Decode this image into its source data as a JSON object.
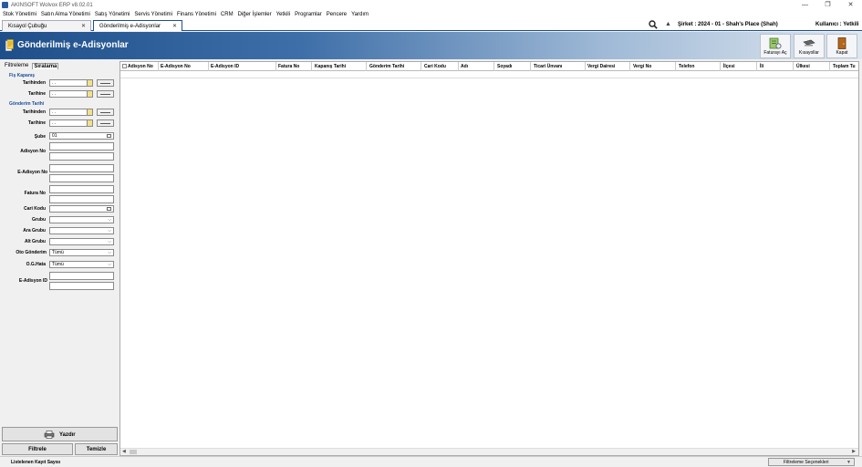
{
  "app": {
    "title": "AKINSOFT Wolvox ERP v8.02.01"
  },
  "window_controls": {
    "minimize": "—",
    "restore": "❐",
    "close": "✕"
  },
  "menu": [
    "Stok Yönetimi",
    "Satın Alma Yönetimi",
    "Satış Yönetimi",
    "Servis Yönetimi",
    "Finans Yönetimi",
    "CRM",
    "Diğer İşlemler",
    "Yetkili",
    "Programlar",
    "Pencere",
    "Yardım"
  ],
  "tabs": [
    {
      "label": "Kısayol Çubuğu",
      "close": "✕"
    },
    {
      "label": "Gönderilmiş e-Adisyonlar",
      "close": "✕"
    }
  ],
  "topbar": {
    "company": "Şirket : 2024 - 01 - Shah's Place (Shah)",
    "user": "Kullanıcı : Yetkili"
  },
  "header": {
    "title": "Gönderilmiş e-Adisyonlar",
    "buttons": [
      "Faturayı Aç",
      "Kısayollar",
      "Kapat"
    ]
  },
  "filter_tabs": [
    "Filtreleme",
    "Sıralama"
  ],
  "filters": {
    "fis_kapanis": "Fiş Kapanış",
    "gonderim_tarihi": "Gönderim Tarihi",
    "date_from": "Tarihinden",
    "date_to": "Tarihine",
    "date_placeholder": ". .",
    "sube_label": "Şube",
    "sube_value": "01",
    "adisyon_no": "Adisyon No",
    "e_adisyon_no": "E-Adisyon No",
    "fatura_no": "Fatura No",
    "cari_kodu": "Cari Kodu",
    "grubu": "Grubu",
    "ara_grubu": "Ara Grubu",
    "alt_grubu": "Alt Grubu",
    "oto_gonderim": "Oto Gönderim",
    "oto_gonderim_value": "Tümü",
    "og_hata": "O.G.Hata",
    "og_hata_value": "Tümü",
    "e_adisyon_id": "E-Adisyon ID"
  },
  "actions": {
    "print": "Yazdır",
    "filter": "Filtrele",
    "clear": "Temizle"
  },
  "grid": {
    "columns": [
      "Adisyon No",
      "E-Adisyon No",
      "E-Adisyon ID",
      "Fatura No",
      "Kapanış Tarihi",
      "Gönderim Tarihi",
      "Cari Kodu",
      "Adı",
      "Soyadı",
      "Ticari Ünvanı",
      "Vergi Dairesi",
      "Vergi No",
      "Telefon",
      "İlçesi",
      "İli",
      "Ülkesi",
      "Toplam Tu"
    ]
  },
  "status": {
    "count_label": "Listelenen Kayıt Sayısı",
    "filter_options": "Filtreleme Seçenekleri"
  },
  "colors": {
    "header_start": "#1f4f8a",
    "section_blue": "#1a4f9a",
    "date_button": "#f2e08a"
  }
}
